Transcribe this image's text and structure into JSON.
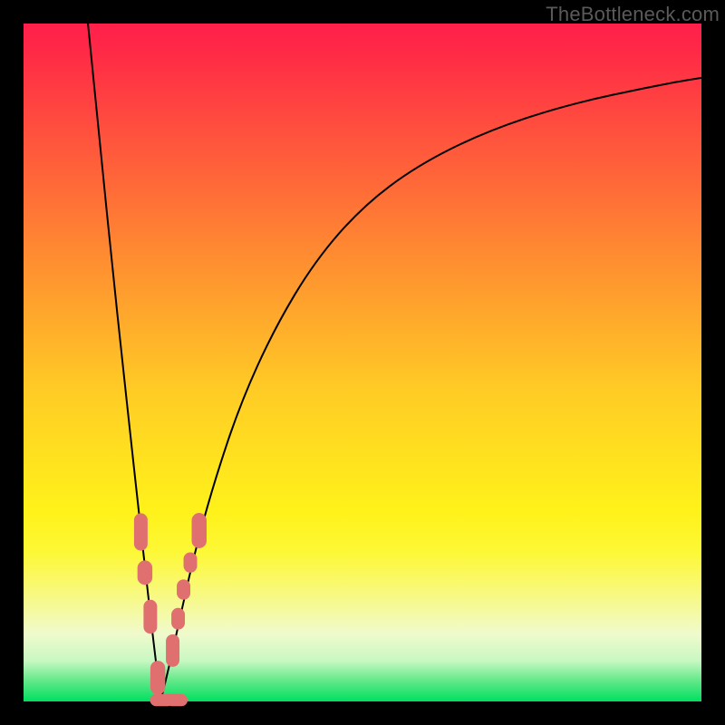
{
  "watermark": "TheBottleneck.com",
  "chart_data": {
    "type": "line",
    "title": "",
    "xlabel": "",
    "ylabel": "",
    "xlim": [
      0,
      100
    ],
    "ylim": [
      0,
      100
    ],
    "grid": false,
    "legend": false,
    "series": [
      {
        "name": "left-branch",
        "x": [
          9.5,
          11.5,
          13.1,
          14.6,
          15.9,
          17.0,
          18.0,
          18.8,
          19.5,
          20.0,
          20.2
        ],
        "y": [
          100,
          80,
          64,
          50,
          38,
          28,
          19,
          12,
          6,
          2,
          0
        ]
      },
      {
        "name": "right-branch",
        "x": [
          20.2,
          21.2,
          22.8,
          25.0,
          28.0,
          32.0,
          37.0,
          43.0,
          50.0,
          58.0,
          68.0,
          80.0,
          94.0,
          100.0
        ],
        "y": [
          0,
          4,
          11,
          21,
          32,
          44,
          55,
          65,
          73,
          79,
          84,
          88,
          91,
          92
        ]
      }
    ],
    "markers": {
      "name": "highlighted-points",
      "color": "#e07070",
      "points": [
        {
          "x": 17.3,
          "y": 25,
          "shape": "capsule-v",
          "w": 2.0,
          "h": 5.5
        },
        {
          "x": 17.9,
          "y": 19,
          "shape": "oval",
          "w": 2.2,
          "h": 3.6
        },
        {
          "x": 18.7,
          "y": 12.5,
          "shape": "capsule-v",
          "w": 2.0,
          "h": 5.0
        },
        {
          "x": 19.8,
          "y": 3.5,
          "shape": "capsule-v",
          "w": 2.2,
          "h": 5.0
        },
        {
          "x": 20.4,
          "y": 0.2,
          "shape": "capsule-h",
          "w": 3.5,
          "h": 1.8
        },
        {
          "x": 22.6,
          "y": 0.2,
          "shape": "capsule-h",
          "w": 3.2,
          "h": 1.8
        },
        {
          "x": 22.0,
          "y": 7.5,
          "shape": "capsule-v",
          "w": 2.0,
          "h": 4.8
        },
        {
          "x": 22.8,
          "y": 12.2,
          "shape": "oval",
          "w": 2.0,
          "h": 3.2
        },
        {
          "x": 23.6,
          "y": 16.5,
          "shape": "oval",
          "w": 2.0,
          "h": 3.0
        },
        {
          "x": 24.6,
          "y": 20.5,
          "shape": "oval",
          "w": 2.0,
          "h": 3.0
        },
        {
          "x": 25.9,
          "y": 25.2,
          "shape": "capsule-v",
          "w": 2.2,
          "h": 5.2
        }
      ]
    },
    "background_gradient": {
      "top": "#ff1f4b",
      "mid": "#ffe11f",
      "bottom": "#00df60"
    }
  }
}
